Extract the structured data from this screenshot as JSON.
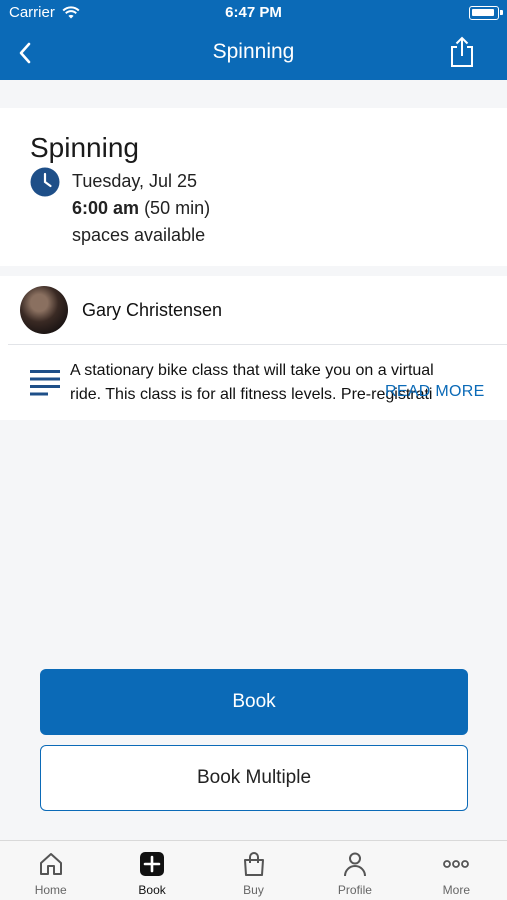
{
  "status_bar": {
    "carrier": "Carrier",
    "time": "6:47 PM"
  },
  "nav": {
    "title": "Spinning"
  },
  "class_info": {
    "name": "Spinning",
    "date": "Tuesday, Jul 25",
    "time_bold": "6:00 am",
    "duration": "(50 min)",
    "spaces": "spaces available"
  },
  "instructor": {
    "name": "Gary Christensen",
    "description_line1": "A stationary bike class that will take you on a virtual",
    "description_line2": "ride.  This class is for all fitness levels.  Pre-registrati",
    "read_more": "READ MORE"
  },
  "actions": {
    "book": "Book",
    "book_multiple": "Book Multiple"
  },
  "tabs": [
    {
      "label": "Home",
      "icon": "home-icon"
    },
    {
      "label": "Book",
      "icon": "plus-square-icon"
    },
    {
      "label": "Buy",
      "icon": "shopping-bag-icon"
    },
    {
      "label": "Profile",
      "icon": "person-icon"
    },
    {
      "label": "More",
      "icon": "more-dots-icon"
    }
  ],
  "colors": {
    "brand": "#0b6ab7",
    "background": "#f5f6f8"
  }
}
